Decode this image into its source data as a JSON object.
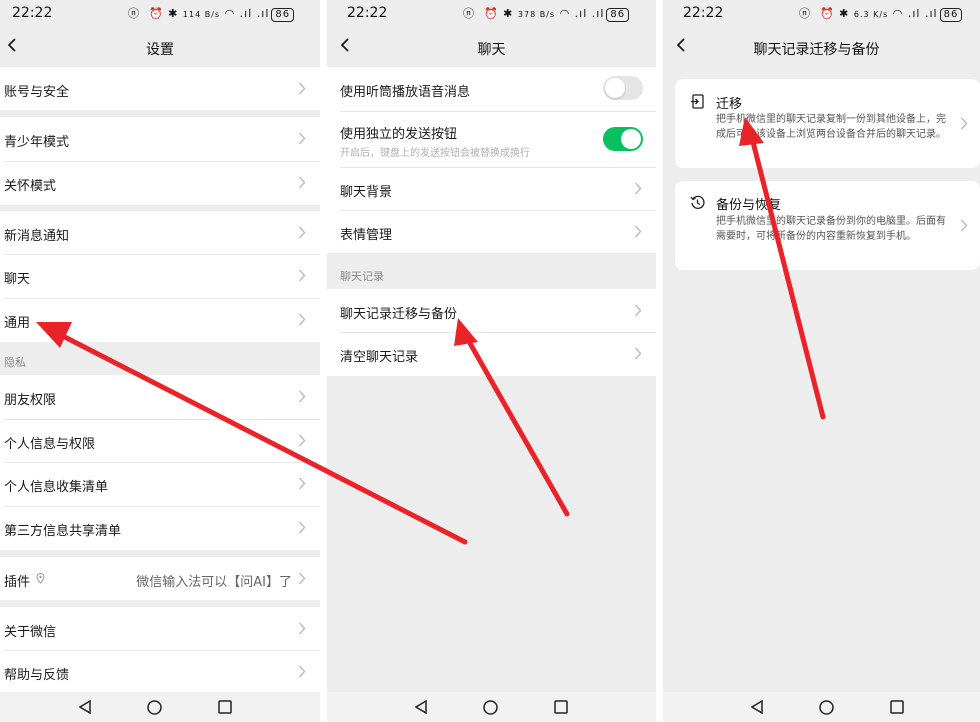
{
  "status": {
    "time": "22:22",
    "battery": "86",
    "speeds": [
      "114 B/s",
      "378 B/s",
      "6.3 K/s"
    ]
  },
  "panel1": {
    "title": "设置",
    "rows": {
      "account": "账号与安全",
      "youth": "青少年模式",
      "care": "关怀模式",
      "notify": "新消息通知",
      "chat": "聊天",
      "general": "通用",
      "privacy_header": "隐私",
      "friends": "朋友权限",
      "personal": "个人信息与权限",
      "collect": "个人信息收集清单",
      "third_party": "第三方信息共享清单",
      "plugins": "插件",
      "plugins_value": "微信输入法可以【问AI】了",
      "about": "关于微信",
      "help": "帮助与反馈"
    }
  },
  "panel2": {
    "title": "聊天",
    "rows": {
      "earpiece": "使用听筒播放语音消息",
      "send_button": "使用独立的发送按钮",
      "send_button_sub": "开启后，键盘上的发送按钮会被替换成换行",
      "background": "聊天背景",
      "stickers": "表情管理",
      "history_header": "聊天记录",
      "migrate": "聊天记录迁移与备份",
      "clear": "清空聊天记录"
    },
    "toggles": {
      "earpiece": false,
      "send_button": true
    }
  },
  "panel3": {
    "title": "聊天记录迁移与备份",
    "migrate": {
      "title": "迁移",
      "desc": "把手机微信里的聊天记录复制一份到其他设备上，完成后可在该设备上浏览两台设备合并后的聊天记录。"
    },
    "backup": {
      "title": "备份与恢复",
      "desc": "把手机微信里的聊天记录备份到你的电脑里。后面有需要时，可将所备份的内容重新恢复到手机。"
    }
  },
  "colors": {
    "accent_green": "#07c160",
    "annotation_red": "#e8232a",
    "background": "#ededed"
  },
  "icons": {
    "back": "chevron-left-icon",
    "chevron": "chevron-right-icon",
    "nav_back": "triangle-back-icon",
    "nav_home": "circle-home-icon",
    "nav_recent": "square-recent-icon",
    "migrate": "transfer-icon",
    "backup": "history-icon"
  }
}
